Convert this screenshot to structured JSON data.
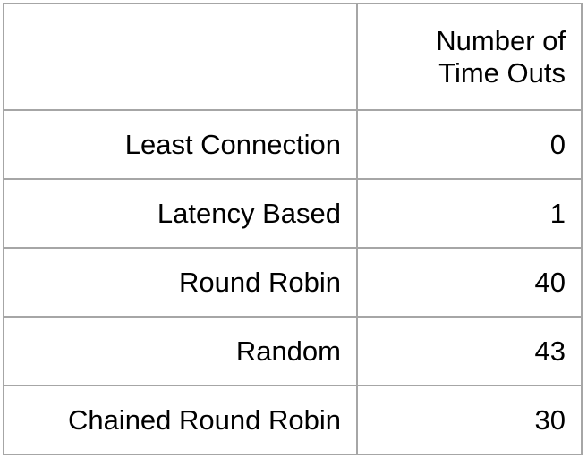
{
  "table": {
    "header": {
      "corner": "",
      "value_line1": "Number of",
      "value_line2": "Time Outs"
    },
    "rows": [
      {
        "label": "Least Connection",
        "value": "0",
        "bold": true
      },
      {
        "label": "Latency Based",
        "value": "1",
        "bold": true
      },
      {
        "label": "Round Robin",
        "value": "40",
        "bold": false
      },
      {
        "label": "Random",
        "value": "43",
        "bold": false
      },
      {
        "label": "Chained Round Robin",
        "value": "30",
        "bold": false
      }
    ]
  }
}
